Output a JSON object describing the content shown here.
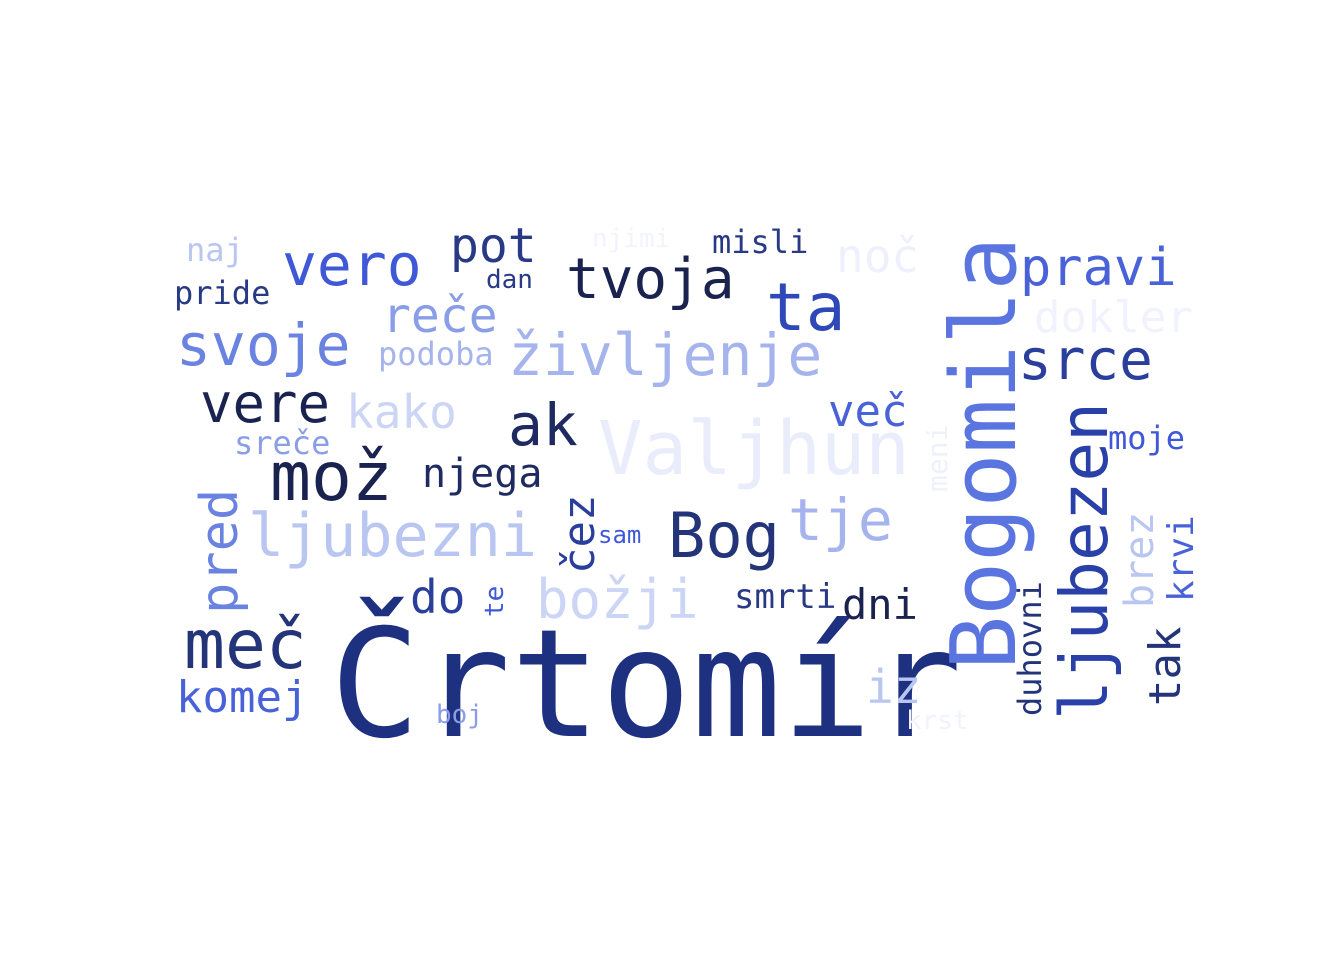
{
  "words": [
    {
      "text": "Črtomír",
      "color": "#1e3080"
    },
    {
      "text": "Bogomila",
      "color": "#5a74e0"
    },
    {
      "text": "Valjhun",
      "color": "#e8ecfb"
    },
    {
      "text": "ljubezen",
      "color": "#2840a8"
    },
    {
      "text": "mož",
      "color": "#1a2250"
    },
    {
      "text": "življenje",
      "color": "#a6b4ee"
    },
    {
      "text": "vero",
      "color": "#3f58d8"
    },
    {
      "text": "svoje",
      "color": "#6a82e0"
    },
    {
      "text": "pravi",
      "color": "#4a62d8"
    },
    {
      "text": "tvoja",
      "color": "#1a2250"
    },
    {
      "text": "ta",
      "color": "#2e48b8"
    },
    {
      "text": "srce",
      "color": "#2a3e9c"
    },
    {
      "text": "vere",
      "color": "#1a2250"
    },
    {
      "text": "meč",
      "color": "#243478"
    },
    {
      "text": "Bog",
      "color": "#243478"
    },
    {
      "text": "tje",
      "color": "#a6b4ee"
    },
    {
      "text": "ak",
      "color": "#1e2a60"
    },
    {
      "text": "ljubezni",
      "color": "#bac6f2"
    },
    {
      "text": "božji",
      "color": "#ccd5f5"
    },
    {
      "text": "pred",
      "color": "#6a82e0"
    },
    {
      "text": "pot",
      "color": "#283a86"
    },
    {
      "text": "reče",
      "color": "#8a9ee8"
    },
    {
      "text": "kako",
      "color": "#ccd5f5"
    },
    {
      "text": "noč",
      "color": "#eef1fc"
    },
    {
      "text": "dokler",
      "color": "#f0f3fd"
    },
    {
      "text": "več",
      "color": "#4a62d8"
    },
    {
      "text": "iz",
      "color": "#bac6f2"
    },
    {
      "text": "komej",
      "color": "#4a62d8"
    },
    {
      "text": "njega",
      "color": "#1e2a60"
    },
    {
      "text": "čez",
      "color": "#2a3e9c"
    },
    {
      "text": "do",
      "color": "#2a3e9c"
    },
    {
      "text": "dni",
      "color": "#1a2250"
    },
    {
      "text": "smrti",
      "color": "#283a86"
    },
    {
      "text": "tak",
      "color": "#243478"
    },
    {
      "text": "brez",
      "color": "#bac6f2"
    },
    {
      "text": "krvi",
      "color": "#4a62d8"
    },
    {
      "text": "moje",
      "color": "#3f58d8"
    },
    {
      "text": "podoba",
      "color": "#a6b4ee"
    },
    {
      "text": "sreče",
      "color": "#8a9ee8"
    },
    {
      "text": "misli",
      "color": "#283a86"
    },
    {
      "text": "njimi",
      "color": "#f2f4fd"
    },
    {
      "text": "naj",
      "color": "#bac6f2"
    },
    {
      "text": "pride",
      "color": "#283a86"
    },
    {
      "text": "dan",
      "color": "#283a86"
    },
    {
      "text": "sam",
      "color": "#3f58d8"
    },
    {
      "text": "te",
      "color": "#3f58d8"
    },
    {
      "text": "boj",
      "color": "#8a9ee8"
    },
    {
      "text": "duhovni",
      "color": "#243478"
    },
    {
      "text": "meni",
      "color": "#eef1fc"
    },
    {
      "text": "krst",
      "color": "#f0f3fd"
    }
  ]
}
